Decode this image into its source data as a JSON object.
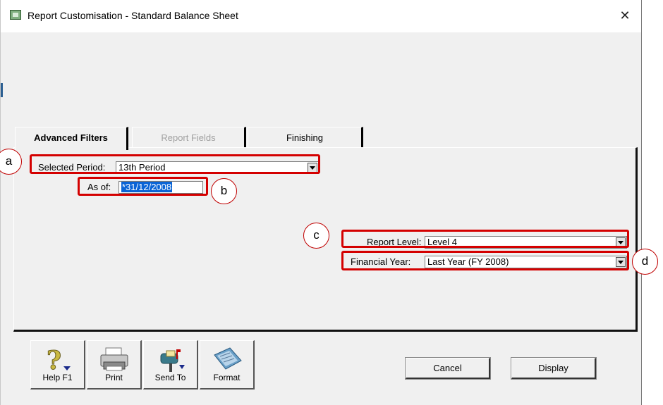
{
  "window": {
    "title": "Report Customisation - Standard Balance Sheet",
    "close_glyph": "✕"
  },
  "tabs": [
    {
      "label": "Advanced Filters",
      "active": true
    },
    {
      "label": "Report Fields",
      "active": false,
      "disabled": true
    },
    {
      "label": "Finishing",
      "active": false
    }
  ],
  "filters": {
    "selected_period": {
      "label": "Selected Period:",
      "value": "13th Period"
    },
    "as_of": {
      "label": "As of:",
      "value": "*31/12/2008"
    },
    "report_level": {
      "label": "Report Level:",
      "value": "Level 4"
    },
    "financial_year": {
      "label": "Financial Year:",
      "value": "Last Year (FY 2008)"
    }
  },
  "callouts": {
    "a": "a",
    "b": "b",
    "c": "c",
    "d": "d"
  },
  "toolbar": [
    {
      "label": "Help F1",
      "icon": "help-question-icon"
    },
    {
      "label": "Print",
      "icon": "printer-icon"
    },
    {
      "label": "Send To",
      "icon": "mailbox-icon"
    },
    {
      "label": "Format",
      "icon": "format-book-icon"
    }
  ],
  "buttons": {
    "cancel": "Cancel",
    "display": "Display"
  },
  "colors": {
    "highlight": "#d40000",
    "selection": "#0a64d6",
    "window_bg": "#f0f0f0"
  }
}
